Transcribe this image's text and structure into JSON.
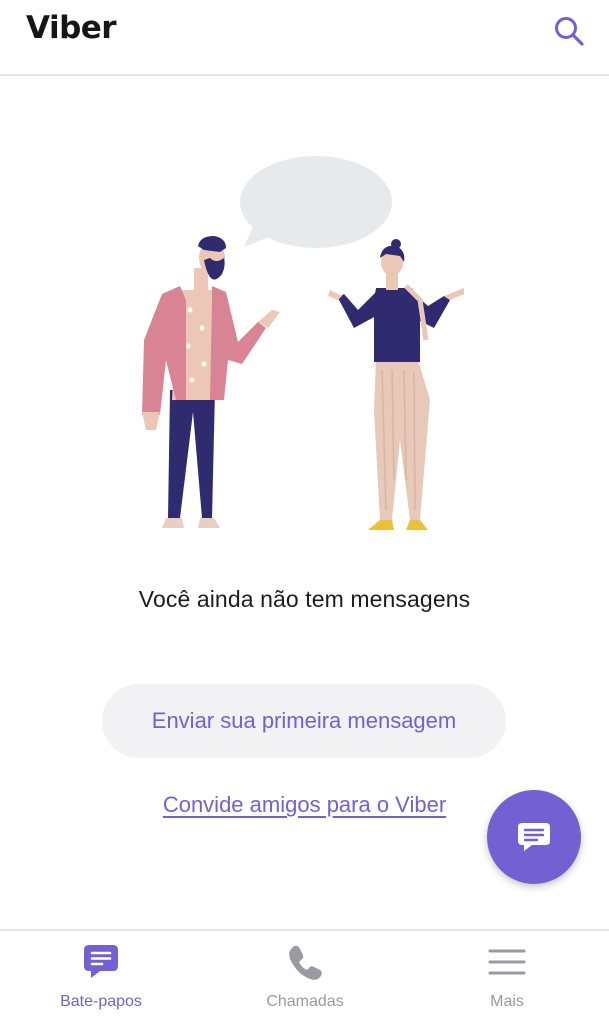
{
  "header": {
    "title": "Viber",
    "search_icon": "search-icon"
  },
  "empty_state": {
    "message": "Você ainda não tem mensagens",
    "primary_button": "Enviar sua primeira mensagem",
    "invite_link": "Convide amigos para o Viber"
  },
  "fab": {
    "icon": "new-chat-icon"
  },
  "bottom_nav": {
    "items": [
      {
        "label": "Bate-papos",
        "icon": "chat-bubble-icon",
        "active": true
      },
      {
        "label": "Chamadas",
        "icon": "phone-icon",
        "active": false
      },
      {
        "label": "Mais",
        "icon": "menu-icon",
        "active": false
      }
    ]
  },
  "colors": {
    "accent": "#7360d2",
    "inactive": "#9a9aa0",
    "button_bg": "#f2f2f4"
  }
}
